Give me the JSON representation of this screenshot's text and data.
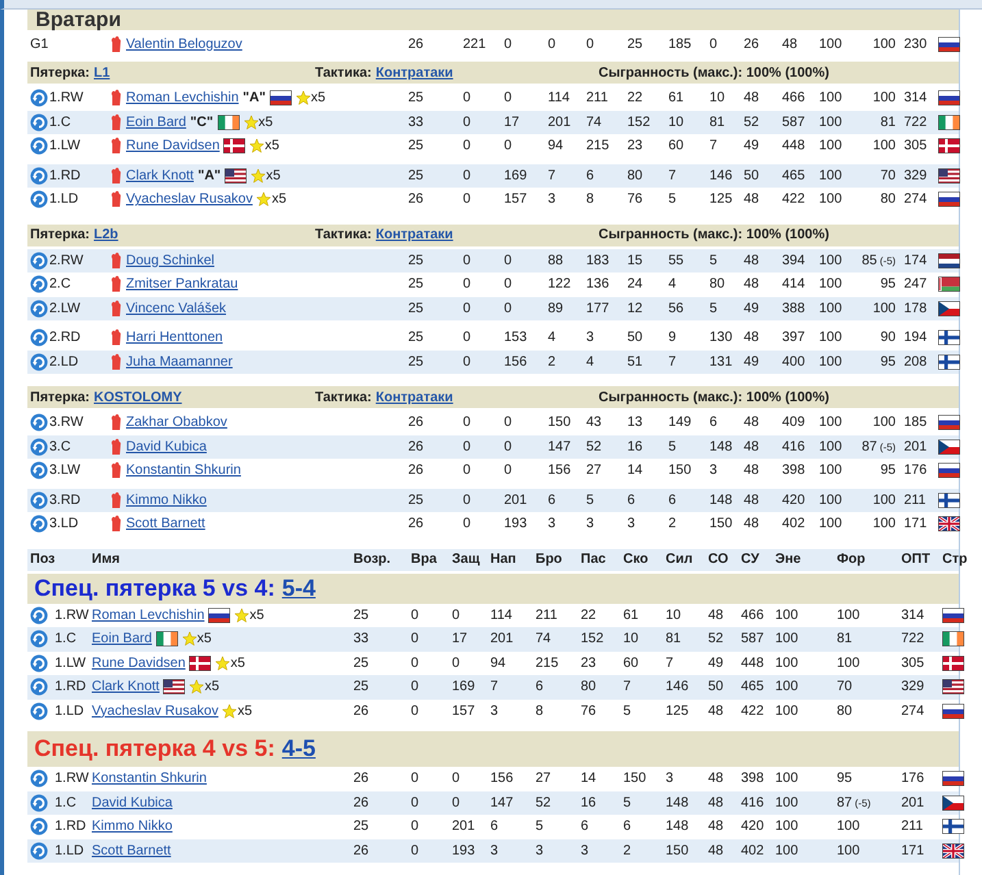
{
  "goalies": {
    "title": "Вратари",
    "rows": [
      {
        "pos": "G1",
        "name": "Valentin Beloguzov",
        "flag": {
          "kind": "ru"
        },
        "values": [
          "26",
          "221",
          "0",
          "0",
          "0",
          "25",
          "185",
          "0",
          "26",
          "48",
          "100",
          "100",
          "230"
        ]
      }
    ]
  },
  "lines": [
    {
      "label": "Пятерка:",
      "name": "L1",
      "tactic_label": "Тактика:",
      "tactic": "Контратаки",
      "chemistry": "Сыгранность (макс.): 100% (100%)",
      "groups": [
        {
          "players": [
            {
              "pos": "1.RW",
              "name": "Roman Levchishin",
              "captain": "\"A\"",
              "inline_flag": {
                "kind": "ru"
              },
              "flag": {
                "kind": "ru"
              },
              "stars_text": "x5",
              "values": [
                "25",
                "0",
                "0",
                "114",
                "211",
                "22",
                "61",
                "10",
                "48",
                "466",
                "100",
                "100",
                "314"
              ]
            },
            {
              "pos": "1.C",
              "name": "Eoin Bard",
              "captain": "\"C\"",
              "inline_flag": {
                "kind": "ie"
              },
              "flag": {
                "kind": "ie"
              },
              "stars_text": "x5",
              "values": [
                "33",
                "0",
                "17",
                "201",
                "74",
                "152",
                "10",
                "81",
                "52",
                "587",
                "100",
                "81",
                "722"
              ]
            },
            {
              "pos": "1.LW",
              "name": "Rune Davidsen",
              "inline_flag": {
                "kind": "dk"
              },
              "flag": {
                "kind": "dk"
              },
              "stars_text": "x5",
              "values": [
                "25",
                "0",
                "0",
                "94",
                "215",
                "23",
                "60",
                "7",
                "49",
                "448",
                "100",
                "100",
                "305"
              ]
            }
          ]
        },
        {
          "players": [
            {
              "pos": "1.RD",
              "name": "Clark Knott",
              "captain": "\"A\"",
              "inline_flag": {
                "kind": "us"
              },
              "flag": {
                "kind": "us"
              },
              "stars_text": "x5",
              "values": [
                "25",
                "0",
                "169",
                "7",
                "6",
                "80",
                "7",
                "146",
                "50",
                "465",
                "100",
                "70",
                "329"
              ]
            },
            {
              "pos": "1.LD",
              "name": "Vyacheslav Rusakov",
              "flag": {
                "kind": "ru"
              },
              "stars_text": "x5",
              "values": [
                "26",
                "0",
                "157",
                "3",
                "8",
                "76",
                "5",
                "125",
                "48",
                "422",
                "100",
                "80",
                "274"
              ]
            }
          ]
        }
      ]
    },
    {
      "label": "Пятерка:",
      "name": "L2b",
      "tactic_label": "Тактика:",
      "tactic": "Контратаки",
      "chemistry": "Сыгранность (макс.): 100% (100%)",
      "groups": [
        {
          "players": [
            {
              "pos": "2.RW",
              "name": "Doug Schinkel",
              "flag": {
                "kind": "nl"
              },
              "form_note": "(-5)",
              "values": [
                "25",
                "0",
                "0",
                "88",
                "183",
                "15",
                "55",
                "5",
                "48",
                "394",
                "100",
                "85",
                "174"
              ]
            },
            {
              "pos": "2.C",
              "name": "Zmitser Pankratau",
              "flag": {
                "kind": "by"
              },
              "values": [
                "25",
                "0",
                "0",
                "122",
                "136",
                "24",
                "4",
                "80",
                "48",
                "414",
                "100",
                "95",
                "247"
              ]
            },
            {
              "pos": "2.LW",
              "name": "Vincenc Valášek",
              "flag": {
                "kind": "cz"
              },
              "values": [
                "25",
                "0",
                "0",
                "89",
                "177",
                "12",
                "56",
                "5",
                "49",
                "388",
                "100",
                "100",
                "178"
              ]
            }
          ]
        },
        {
          "players": [
            {
              "pos": "2.RD",
              "name": "Harri Henttonen",
              "flag": {
                "kind": "fi"
              },
              "values": [
                "25",
                "0",
                "153",
                "4",
                "3",
                "50",
                "9",
                "130",
                "48",
                "397",
                "100",
                "90",
                "194"
              ]
            },
            {
              "pos": "2.LD",
              "name": "Juha Maamanner",
              "flag": {
                "kind": "fi"
              },
              "values": [
                "25",
                "0",
                "156",
                "2",
                "4",
                "51",
                "7",
                "131",
                "49",
                "400",
                "100",
                "95",
                "208"
              ]
            }
          ]
        }
      ]
    },
    {
      "label": "Пятерка:",
      "name": "KOSTOLOMY",
      "tactic_label": "Тактика:",
      "tactic": "Контратаки",
      "chemistry": "Сыгранность (макс.): 100% (100%)",
      "groups": [
        {
          "players": [
            {
              "pos": "3.RW",
              "name": "Zakhar Obabkov",
              "flag": {
                "kind": "ru"
              },
              "values": [
                "26",
                "0",
                "0",
                "150",
                "43",
                "13",
                "149",
                "6",
                "48",
                "409",
                "100",
                "100",
                "185"
              ]
            },
            {
              "pos": "3.C",
              "name": "David Kubica",
              "flag": {
                "kind": "cz"
              },
              "form_note": "(-5)",
              "values": [
                "26",
                "0",
                "0",
                "147",
                "52",
                "16",
                "5",
                "148",
                "48",
                "416",
                "100",
                "87",
                "201"
              ]
            },
            {
              "pos": "3.LW",
              "name": "Konstantin Shkurin",
              "flag": {
                "kind": "ru"
              },
              "values": [
                "26",
                "0",
                "0",
                "156",
                "27",
                "14",
                "150",
                "3",
                "48",
                "398",
                "100",
                "95",
                "176"
              ]
            }
          ]
        },
        {
          "players": [
            {
              "pos": "3.RD",
              "name": "Kimmo Nikko",
              "flag": {
                "kind": "fi"
              },
              "values": [
                "25",
                "0",
                "201",
                "6",
                "5",
                "6",
                "6",
                "148",
                "48",
                "420",
                "100",
                "100",
                "211"
              ]
            },
            {
              "pos": "3.LD",
              "name": "Scott Barnett",
              "flag": {
                "kind": "gb"
              },
              "values": [
                "26",
                "0",
                "193",
                "3",
                "3",
                "3",
                "2",
                "150",
                "48",
                "402",
                "100",
                "100",
                "171"
              ]
            }
          ]
        }
      ]
    }
  ],
  "special": {
    "columns": [
      "Поз",
      "Имя",
      "Возр.",
      "Вра",
      "Защ",
      "Нап",
      "Бро",
      "Пас",
      "Ско",
      "Сил",
      "СО",
      "СУ",
      "Эне",
      "Фор",
      "ОПТ",
      "Стр"
    ],
    "units": [
      {
        "kind": "powerplay",
        "title": "Спец. пятерка 5 vs 4:",
        "link": "5-4",
        "players": [
          {
            "pos": "1.RW",
            "name": "Roman Levchishin",
            "inline_flag": {
              "kind": "ru"
            },
            "flag": {
              "kind": "ru"
            },
            "stars_text": "x5",
            "values": [
              "25",
              "0",
              "0",
              "114",
              "211",
              "22",
              "61",
              "10",
              "48",
              "466",
              "100",
              "100",
              "314"
            ]
          },
          {
            "pos": "1.C",
            "name": "Eoin Bard",
            "inline_flag": {
              "kind": "ie"
            },
            "flag": {
              "kind": "ie"
            },
            "stars_text": "x5",
            "values": [
              "33",
              "0",
              "17",
              "201",
              "74",
              "152",
              "10",
              "81",
              "52",
              "587",
              "100",
              "81",
              "722"
            ]
          },
          {
            "pos": "1.LW",
            "name": "Rune Davidsen",
            "inline_flag": {
              "kind": "dk"
            },
            "flag": {
              "kind": "dk"
            },
            "stars_text": "x5",
            "values": [
              "25",
              "0",
              "0",
              "94",
              "215",
              "23",
              "60",
              "7",
              "49",
              "448",
              "100",
              "100",
              "305"
            ]
          },
          {
            "pos": "1.RD",
            "name": "Clark Knott",
            "inline_flag": {
              "kind": "us"
            },
            "flag": {
              "kind": "us"
            },
            "stars_text": "x5",
            "values": [
              "25",
              "0",
              "169",
              "7",
              "6",
              "80",
              "7",
              "146",
              "50",
              "465",
              "100",
              "70",
              "329"
            ]
          },
          {
            "pos": "1.LD",
            "name": "Vyacheslav Rusakov",
            "flag": {
              "kind": "ru"
            },
            "stars_text": "x5",
            "values": [
              "26",
              "0",
              "157",
              "3",
              "8",
              "76",
              "5",
              "125",
              "48",
              "422",
              "100",
              "80",
              "274"
            ]
          }
        ]
      },
      {
        "kind": "penalty_kill",
        "title": "Спец. пятерка 4 vs 5:",
        "link": "4-5",
        "players": [
          {
            "pos": "1.RW",
            "name": "Konstantin Shkurin",
            "flag": {
              "kind": "ru"
            },
            "values": [
              "26",
              "0",
              "0",
              "156",
              "27",
              "14",
              "150",
              "3",
              "48",
              "398",
              "100",
              "95",
              "176"
            ]
          },
          {
            "pos": "1.C",
            "name": "David Kubica",
            "flag": {
              "kind": "cz"
            },
            "form_note": "(-5)",
            "values": [
              "26",
              "0",
              "0",
              "147",
              "52",
              "16",
              "5",
              "148",
              "48",
              "416",
              "100",
              "87",
              "201"
            ]
          },
          {
            "pos": "1.RD",
            "name": "Kimmo Nikko",
            "flag": {
              "kind": "fi"
            },
            "values": [
              "25",
              "0",
              "201",
              "6",
              "5",
              "6",
              "6",
              "148",
              "48",
              "420",
              "100",
              "100",
              "211"
            ]
          },
          {
            "pos": "1.LD",
            "name": "Scott Barnett",
            "flag": {
              "kind": "gb"
            },
            "values": [
              "26",
              "0",
              "193",
              "3",
              "3",
              "3",
              "2",
              "150",
              "48",
              "402",
              "100",
              "100",
              "171"
            ]
          }
        ]
      }
    ]
  }
}
